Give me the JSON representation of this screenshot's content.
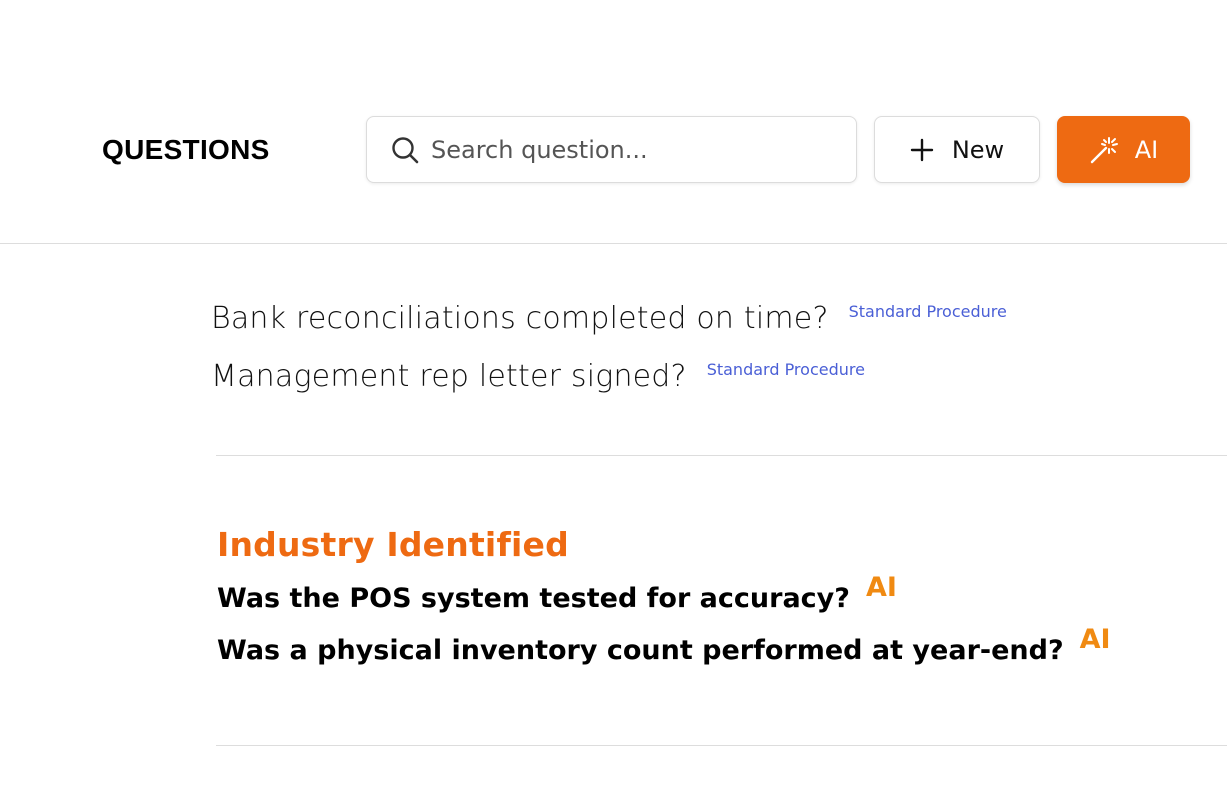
{
  "header": {
    "title": "QUESTIONS",
    "search": {
      "placeholder": "Search question...",
      "value": ""
    },
    "new_button_label": "New",
    "ai_button_label": "AI"
  },
  "standard_questions": [
    {
      "text": "Bank reconciliations completed on time?",
      "tag": "Standard Procedure"
    },
    {
      "text": "Management rep letter signed?",
      "tag": "Standard Procedure"
    }
  ],
  "industry_section": {
    "title": "Industry Identified",
    "questions": [
      {
        "text": "Was the POS system tested for accuracy?",
        "tag": "AI"
      },
      {
        "text": "Was a physical inventory count performed at year-end?",
        "tag": "AI"
      }
    ]
  },
  "colors": {
    "accent": "#ee6a12",
    "ai_tag": "#f08a12",
    "standard_tag": "#4a5fd6"
  },
  "icons": {
    "search": "search-icon",
    "new": "plus-icon",
    "ai": "magic-wand-icon"
  }
}
